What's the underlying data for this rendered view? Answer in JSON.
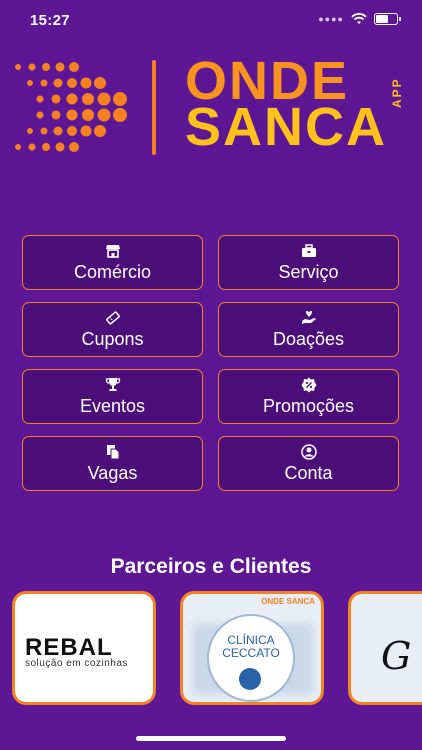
{
  "status_bar": {
    "time": "15:27"
  },
  "brand": {
    "line1": "ONDE",
    "line2": "SANCA",
    "app": "APP"
  },
  "menu": [
    {
      "label": "Comércio",
      "icon": "store-icon"
    },
    {
      "label": "Serviço",
      "icon": "toolbox-icon"
    },
    {
      "label": "Cupons",
      "icon": "ticket-icon"
    },
    {
      "label": "Doações",
      "icon": "hand-heart-icon"
    },
    {
      "label": "Eventos",
      "icon": "trophy-icon"
    },
    {
      "label": "Promoções",
      "icon": "badge-percent-icon"
    },
    {
      "label": "Vagas",
      "icon": "documents-icon"
    },
    {
      "label": "Conta",
      "icon": "user-circle-icon"
    }
  ],
  "partners": {
    "title": "Parceiros e Clientes",
    "items": [
      {
        "name": "REBAL",
        "tagline": "solução em cozinhas"
      },
      {
        "name": "CLÍNICA CECCATO",
        "badge": "ONDE SANCA"
      },
      {
        "name": "G"
      }
    ]
  },
  "colors": {
    "background": "#5d1694",
    "accent": "#f58220",
    "yellow": "#ffc21a",
    "button_fill": "#4c0f7a"
  }
}
